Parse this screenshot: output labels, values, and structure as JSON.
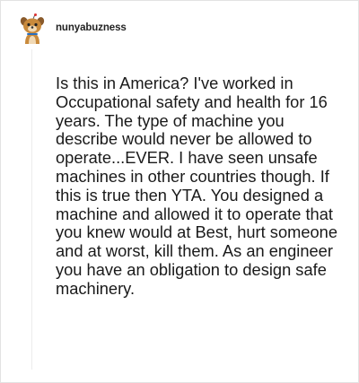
{
  "comment": {
    "avatar_icon": "dog-snoo-avatar-icon",
    "username": "nunyabuzness",
    "body": "Is this in America? I've worked in Occupational safety and health for 16 years. The type of machine you describe would never be allowed to operate...EVER. I have seen unsafe machines in other countries though. If this is true then YTA. You designed a machine and allowed it to operate that you knew would at Best, hurt someone and at worst, kill them. As an engineer you have an obligation to design safe machinery."
  }
}
